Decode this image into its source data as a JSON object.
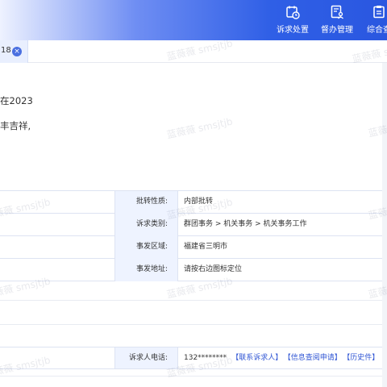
{
  "header": {
    "nav": [
      {
        "label": "诉求处置",
        "icon": "calendar-clock-icon"
      },
      {
        "label": "督办管理",
        "icon": "document-user-icon"
      },
      {
        "label": "综合查",
        "icon": "clipboard-icon"
      }
    ]
  },
  "tab": {
    "label": "18",
    "close": "×"
  },
  "content": {
    "line1": "在2023",
    "line2": "丰吉祥,"
  },
  "details": [
    {
      "label": "批转性质:",
      "value": "内部批转"
    },
    {
      "label": "诉求类别:",
      "value": "群团事务 > 机关事务 > 机关事务工作"
    },
    {
      "label": "事发区域:",
      "value": "福建省三明市"
    },
    {
      "label": "事发地址:",
      "value": "请按右边图标定位"
    }
  ],
  "petitioner": {
    "label": "诉求人电话:",
    "phone": "132********",
    "links": [
      "【联系诉求人】",
      "【信息查阅申请】",
      "【历史件】"
    ]
  },
  "watermark": "蓝薇薇 smsjtjb"
}
